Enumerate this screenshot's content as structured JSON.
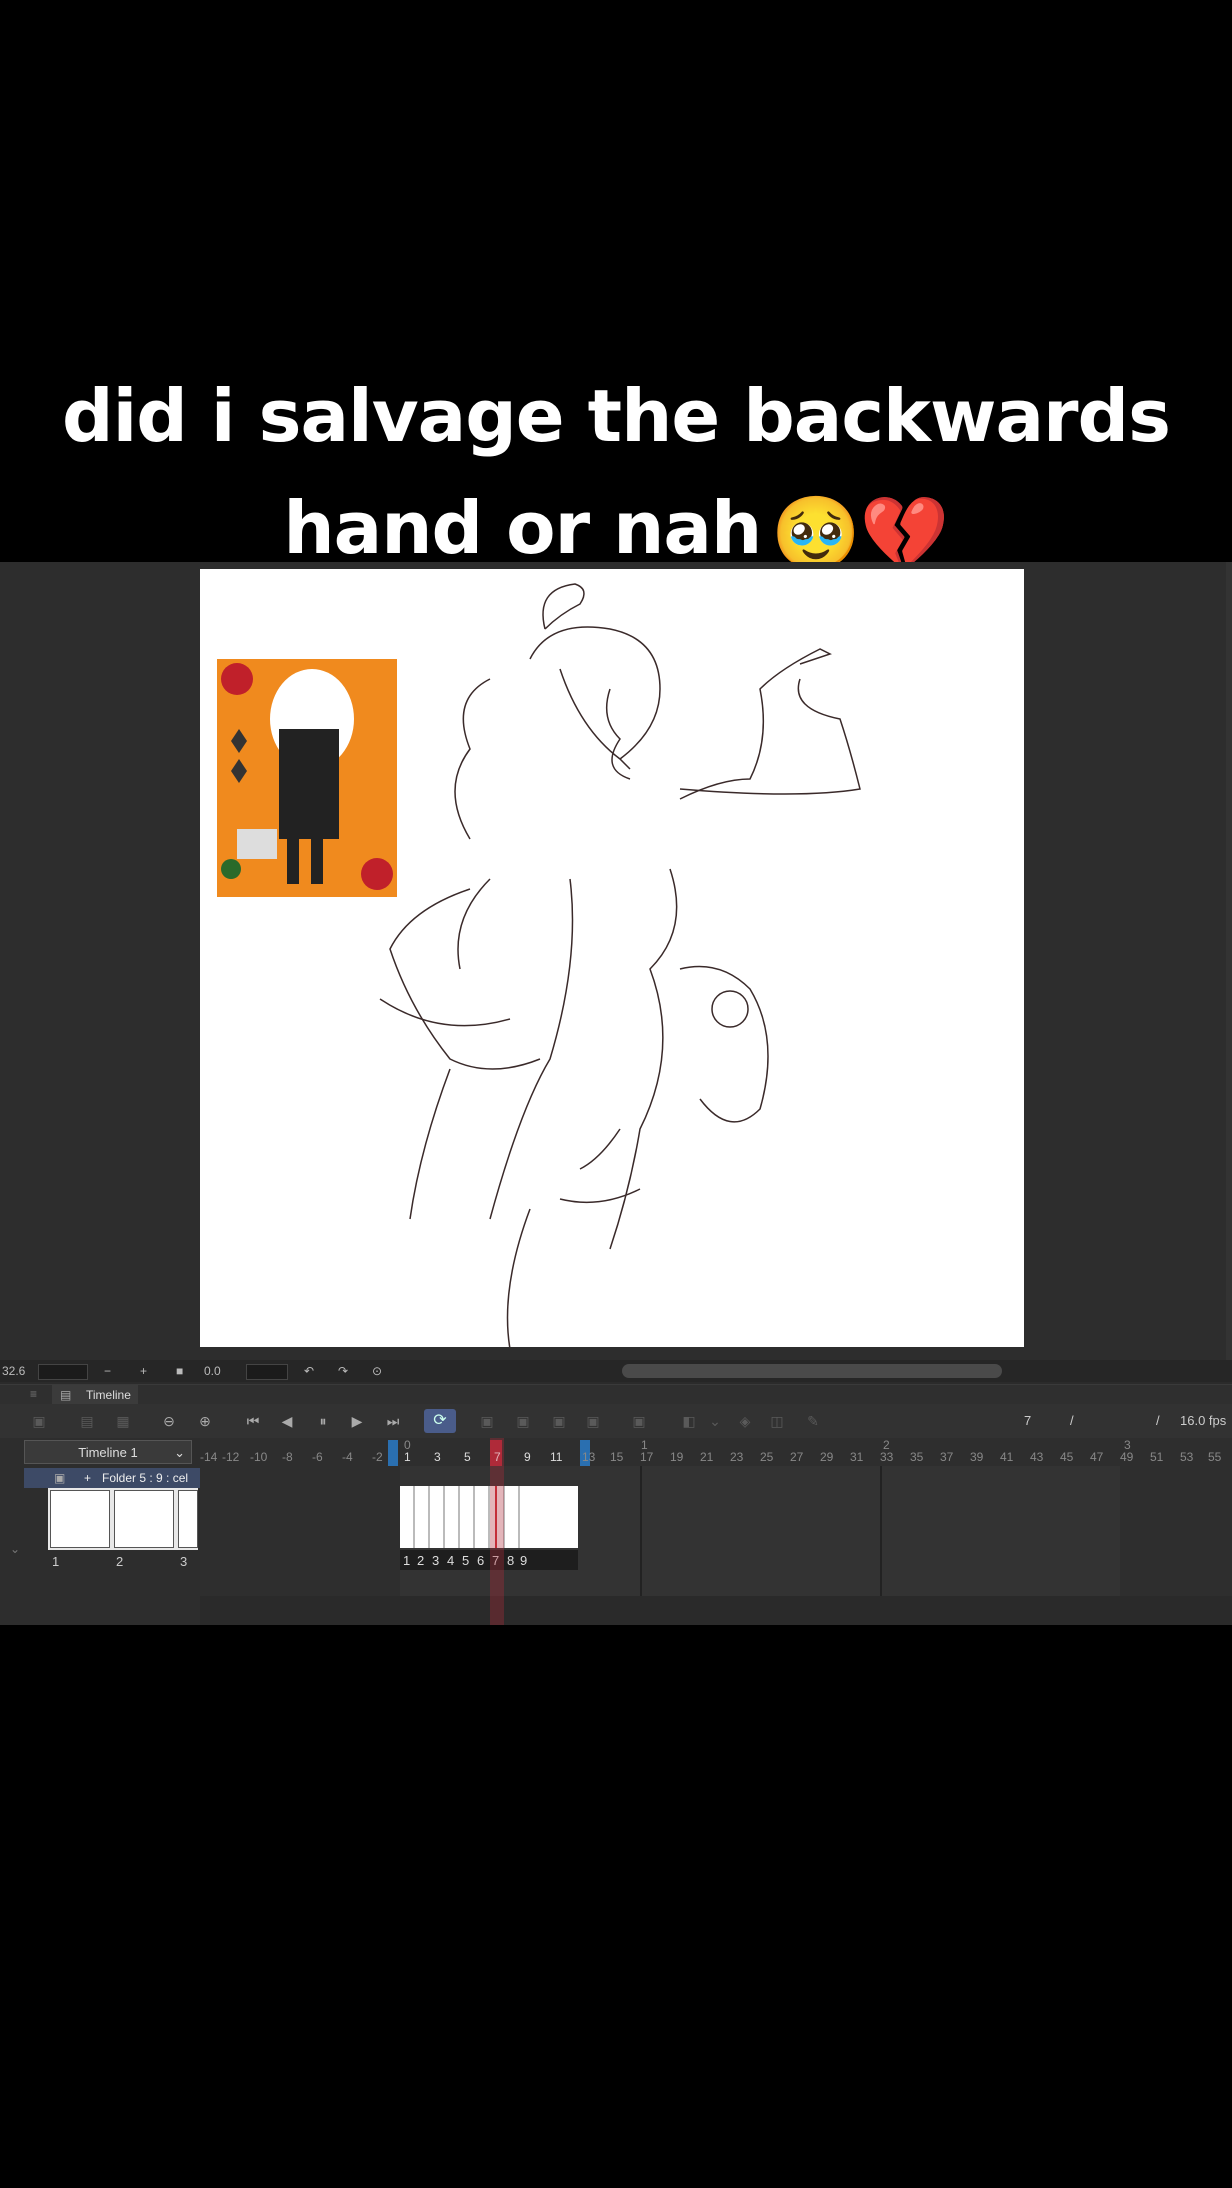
{
  "caption": {
    "line1": "did i salvage the backwards",
    "line2": "hand or nah",
    "emoji": "🥹💔"
  },
  "statusbar": {
    "zoom": "32.6",
    "rotation": "0.0",
    "minus": "−",
    "plus": "+"
  },
  "panel": {
    "tab_label": "Timeline"
  },
  "toolbar": {
    "current_frame": "7",
    "sep1": "/",
    "sep2": "/",
    "fps": "16.0 fps"
  },
  "timeline": {
    "name": "Timeline 1",
    "layer_label": "Folder 5 : 9 : cel",
    "ruler_ticks": [
      "-14",
      "-12",
      "-10",
      "-8",
      "-6",
      "-4",
      "-2",
      "0",
      "1",
      "3",
      "5",
      "7",
      "9",
      "11",
      "13",
      "15",
      "17",
      "19",
      "21",
      "23",
      "25",
      "27",
      "29",
      "31",
      "33",
      "35",
      "37",
      "39",
      "41",
      "43",
      "45",
      "47",
      "49",
      "51",
      "53",
      "55"
    ],
    "ruler_top": [
      "0",
      "1",
      "2",
      "3"
    ],
    "cell_numbers": [
      "1",
      "2",
      "3",
      "4",
      "5",
      "6",
      "7",
      "8",
      "9"
    ],
    "thumb_numbers": [
      "1",
      "2",
      "3"
    ]
  }
}
